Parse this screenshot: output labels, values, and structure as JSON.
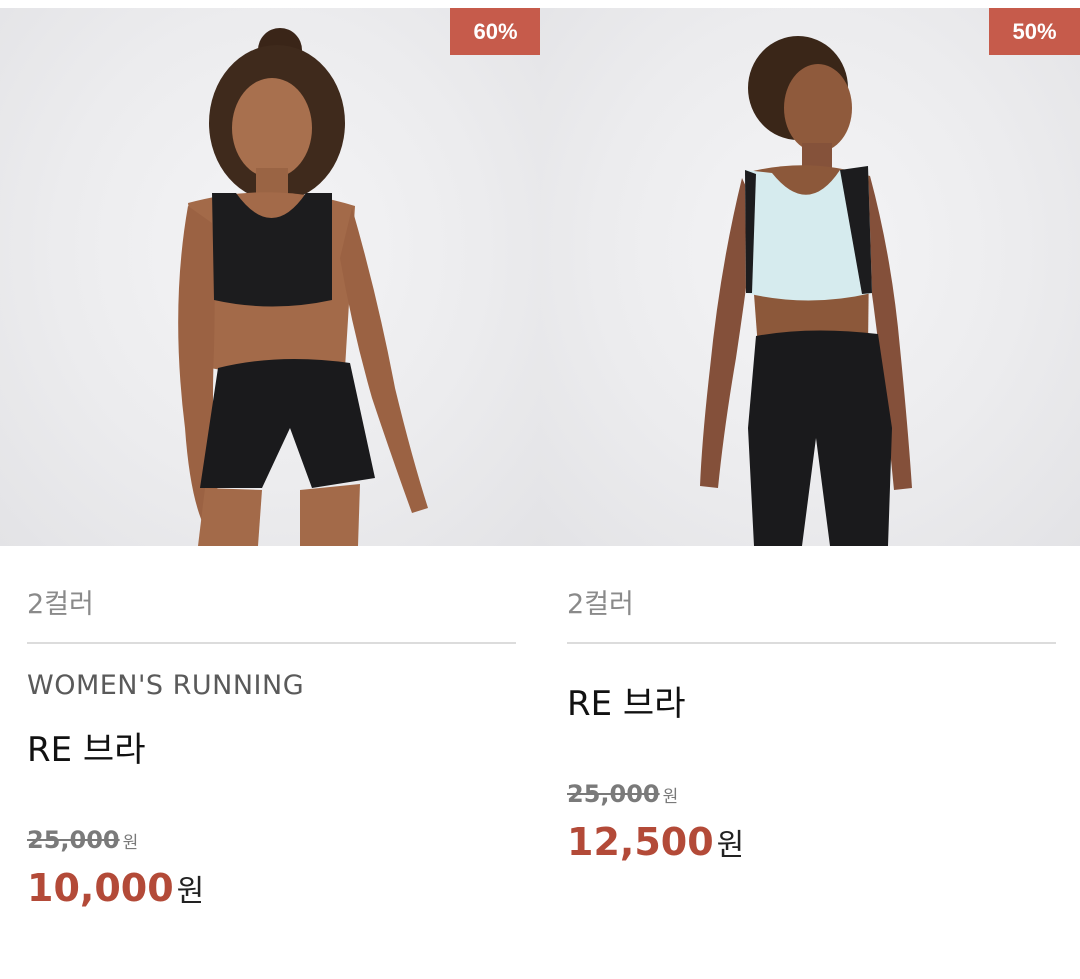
{
  "products": [
    {
      "discount_badge": "60%",
      "color_count": "2컬러",
      "category": "WOMEN'S RUNNING",
      "name": "RE 브라",
      "original_price": "25,000",
      "original_unit": "원",
      "sale_price": "10,000",
      "sale_unit": "원",
      "image": "woman in black sports bra and black running shorts"
    },
    {
      "discount_badge": "50%",
      "color_count": "2컬러",
      "category": "",
      "name": "RE 브라",
      "original_price": "25,000",
      "original_unit": "원",
      "sale_price": "12,500",
      "sale_unit": "원",
      "image": "woman in light mint and black sports bra with black leggings"
    }
  ],
  "colors": {
    "badge": "#c65b4b",
    "sale_price": "#b34a38",
    "muted_text": "#8a8a8a",
    "divider": "#dcdcdc"
  }
}
